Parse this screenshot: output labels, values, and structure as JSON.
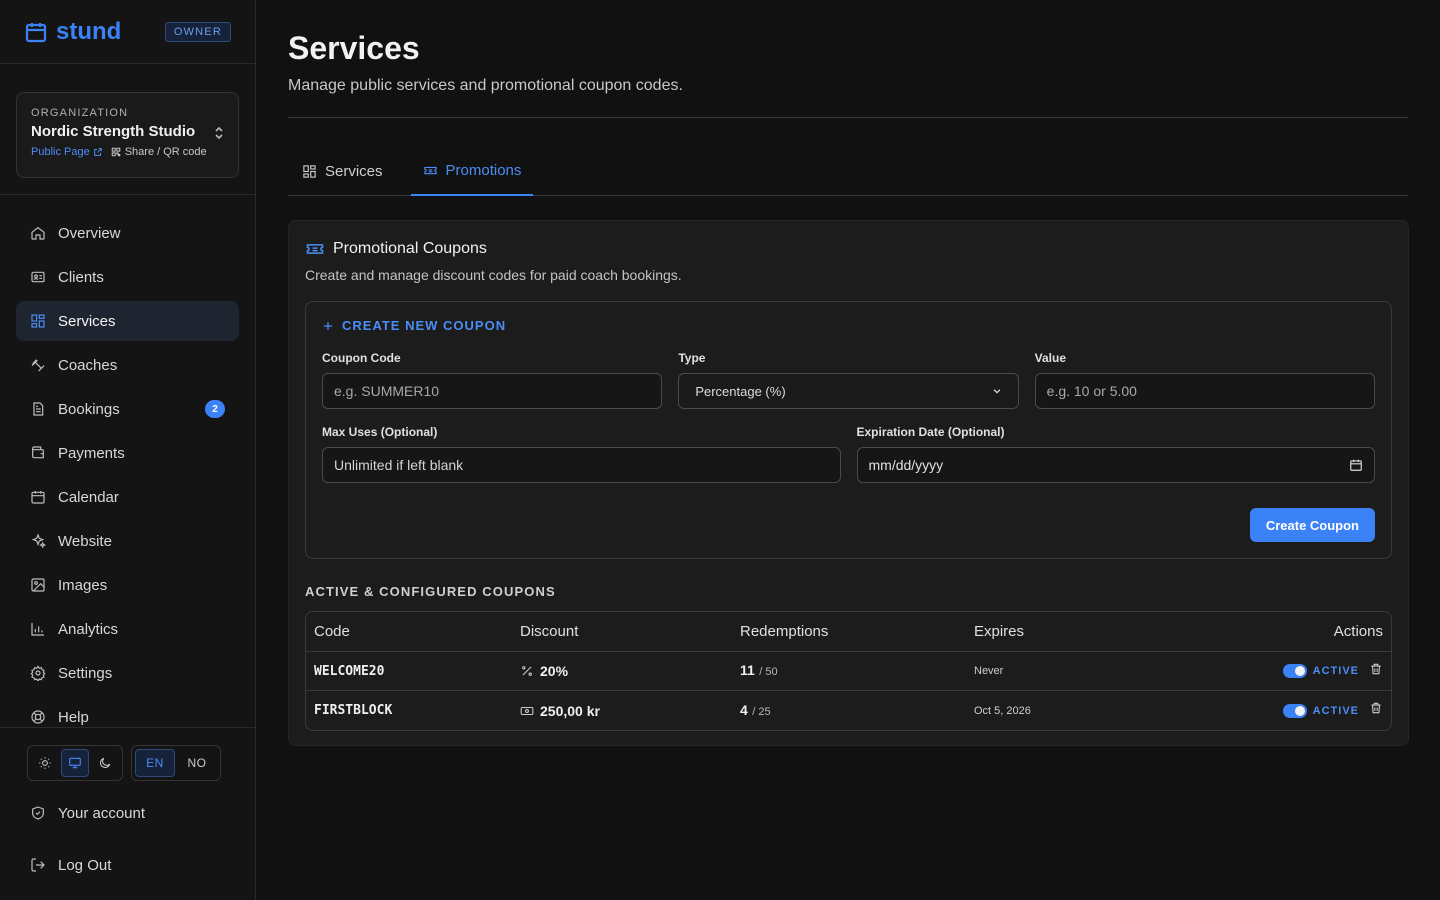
{
  "brand": {
    "name": "stund",
    "role_badge": "OWNER"
  },
  "org": {
    "label": "ORGANIZATION",
    "name": "Nordic Strength Studio",
    "public_link": "Public Page",
    "share_link": "Share / QR code"
  },
  "nav": {
    "items": [
      {
        "label": "Overview",
        "icon": "home-icon"
      },
      {
        "label": "Clients",
        "icon": "id-card-icon"
      },
      {
        "label": "Services",
        "icon": "grid-icon",
        "active": true
      },
      {
        "label": "Coaches",
        "icon": "dumbbell-icon"
      },
      {
        "label": "Bookings",
        "icon": "document-icon",
        "badge": "2"
      },
      {
        "label": "Payments",
        "icon": "wallet-icon"
      },
      {
        "label": "Calendar",
        "icon": "calendar-icon"
      },
      {
        "label": "Website",
        "icon": "sparkle-icon"
      },
      {
        "label": "Images",
        "icon": "image-icon"
      },
      {
        "label": "Analytics",
        "icon": "bar-chart-icon"
      },
      {
        "label": "Settings",
        "icon": "gear-icon"
      },
      {
        "label": "Help",
        "icon": "lifebuoy-icon"
      }
    ]
  },
  "preferences": {
    "theme_options": [
      "light",
      "system",
      "dark"
    ],
    "theme_selected": "system",
    "languages": [
      "EN",
      "NO"
    ],
    "language_selected": "EN"
  },
  "account": {
    "your_account": "Your account",
    "logout": "Log Out"
  },
  "page": {
    "title": "Services",
    "subtitle": "Manage public services and promotional coupon codes."
  },
  "tabs": [
    {
      "label": "Services",
      "active": false
    },
    {
      "label": "Promotions",
      "active": true
    }
  ],
  "coupons": {
    "title": "Promotional Coupons",
    "subtitle": "Create and manage discount codes for paid coach bookings.",
    "create": {
      "heading": "CREATE NEW COUPON",
      "code_label": "Coupon Code",
      "code_placeholder": "e.g. SUMMER10",
      "type_label": "Type",
      "type_value": "Percentage (%)",
      "value_label": "Value",
      "value_placeholder": "e.g. 10 or 5.00",
      "max_uses_label": "Max Uses (Optional)",
      "max_uses_placeholder": "Unlimited if left blank",
      "expiration_label": "Expiration Date (Optional)",
      "expiration_placeholder": "mm/dd/yyyy",
      "submit": "Create Coupon"
    },
    "list_label": "ACTIVE & CONFIGURED COUPONS",
    "columns": [
      "Code",
      "Discount",
      "Redemptions",
      "Expires",
      "Actions"
    ],
    "rows": [
      {
        "code": "WELCOME20",
        "discount": "20%",
        "discount_type": "percent",
        "used": "11",
        "max": "/ 50",
        "expires": "Never",
        "status": "ACTIVE",
        "enabled": true
      },
      {
        "code": "FIRSTBLOCK",
        "discount": "250,00 kr",
        "discount_type": "fixed",
        "used": "4",
        "max": "/ 25",
        "expires": "Oct 5, 2026",
        "status": "ACTIVE",
        "enabled": true
      }
    ]
  },
  "colors": {
    "accent": "#3b82f6",
    "background": "#111111",
    "panel": "#1c1c1c"
  }
}
